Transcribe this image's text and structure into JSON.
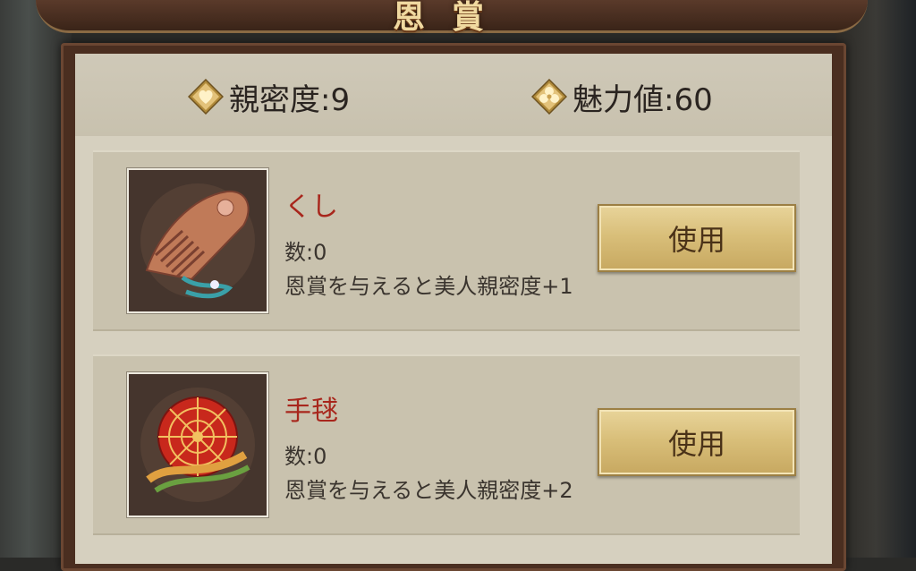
{
  "header": {
    "title": "恩賞"
  },
  "stats": {
    "intimacy": "親密度:9",
    "charm": "魅力値:60"
  },
  "items": [
    {
      "name": "くし",
      "count": "数:0",
      "desc": "恩賞を与えると美人親密度+1",
      "use_label": "使用",
      "image_icon": "comb-icon"
    },
    {
      "name": "手毬",
      "count": "数:0",
      "desc": "恩賞を与えると美人親密度+2",
      "use_label": "使用",
      "image_icon": "temari-ball-icon"
    }
  ],
  "colors": {
    "item_name": "#a8261c",
    "button": "#d9bf7a",
    "panel": "#d6d0bf"
  }
}
